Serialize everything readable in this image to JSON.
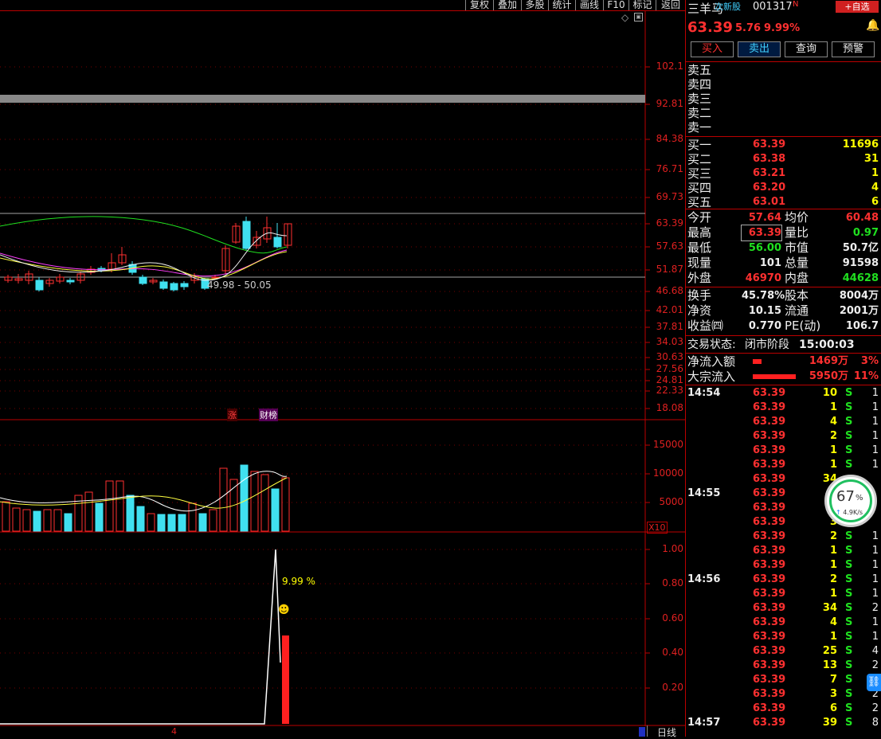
{
  "toolbar": {
    "buttons": [
      "复权",
      "叠加",
      "多股",
      "统计",
      "画线",
      "F10",
      "标记",
      "返回"
    ]
  },
  "kline": {
    "y_labels": [
      "102.1",
      "92.81",
      "84.38",
      "76.71",
      "69.73",
      "63.39",
      "57.63",
      "51.87",
      "46.68",
      "42.01",
      "37.81",
      "34.03",
      "30.63",
      "27.56",
      "24.81",
      "22.33",
      "18.08"
    ],
    "range_label": "49.98 - 50.05",
    "tags": [
      "涨",
      "财榜"
    ]
  },
  "volume": {
    "y_labels": [
      "15000",
      "10000",
      "5000"
    ],
    "unit": "X10"
  },
  "indicator": {
    "y_labels": [
      "1.00",
      "0.80",
      "0.60",
      "0.40",
      "0.20"
    ],
    "pct_label": "9.99 %"
  },
  "bottom": {
    "date_mark": "4",
    "period": "日线"
  },
  "stock": {
    "name": "三羊马",
    "tag": "次新股",
    "code": "001317",
    "n": "N",
    "add_button": "+自选",
    "price": "63.39",
    "change": "5.76",
    "pct": "9.99%"
  },
  "actions": [
    "买入",
    "卖出",
    "查询",
    "预警"
  ],
  "sells": [
    "卖五",
    "卖四",
    "卖三",
    "卖二",
    "卖一"
  ],
  "buys": [
    {
      "label": "买一",
      "price": "63.39",
      "vol": "11696"
    },
    {
      "label": "买二",
      "price": "63.38",
      "vol": "31"
    },
    {
      "label": "买三",
      "price": "63.21",
      "vol": "1"
    },
    {
      "label": "买四",
      "price": "63.20",
      "vol": "4"
    },
    {
      "label": "买五",
      "price": "63.01",
      "vol": "6"
    }
  ],
  "stats": [
    {
      "l1": "今开",
      "v1": "57.64",
      "l2": "均价",
      "v2": "60.48"
    },
    {
      "l1": "最高",
      "v1": "63.39",
      "l2": "量比",
      "v2": "0.97"
    },
    {
      "l1": "最低",
      "v1": "56.00",
      "l2": "市值",
      "v2": "50.7亿"
    },
    {
      "l1": "现量",
      "v1": "101",
      "l2": "总量",
      "v2": "91598"
    },
    {
      "l1": "外盘",
      "v1": "46970",
      "l2": "内盘",
      "v2": "44628"
    }
  ],
  "stats2": [
    {
      "l1": "换手",
      "v1": "45.78%",
      "l2": "股本",
      "v2": "8004万"
    },
    {
      "l1": "净资",
      "v1": "10.15",
      "l2": "流通",
      "v2": "2001万"
    },
    {
      "l1": "收益㈣",
      "v1": "0.770",
      "l2": "PE(动)",
      "v2": "106.7"
    }
  ],
  "status": {
    "label": "交易状态:",
    "value": "闭市阶段",
    "time": "15:00:03"
  },
  "flows": [
    {
      "label": "净流入额",
      "value": "1469万",
      "pct": "3%",
      "fill": 0.2
    },
    {
      "label": "大宗流入",
      "value": "5950万",
      "pct": "11%",
      "fill": 1.0
    }
  ],
  "ticks": [
    {
      "time": "14:54",
      "price": "63.39",
      "vol": "10",
      "side": "S",
      "n": "1"
    },
    {
      "time": "",
      "price": "63.39",
      "vol": "1",
      "side": "S",
      "n": "1"
    },
    {
      "time": "",
      "price": "63.39",
      "vol": "4",
      "side": "S",
      "n": "1"
    },
    {
      "time": "",
      "price": "63.39",
      "vol": "2",
      "side": "S",
      "n": "1"
    },
    {
      "time": "",
      "price": "63.39",
      "vol": "1",
      "side": "S",
      "n": "1"
    },
    {
      "time": "",
      "price": "63.39",
      "vol": "1",
      "side": "S",
      "n": "1"
    },
    {
      "time": "",
      "price": "63.39",
      "vol": "34",
      "side": "",
      "n": ""
    },
    {
      "time": "14:55",
      "price": "63.39",
      "vol": "",
      "side": "",
      "n": ""
    },
    {
      "time": "",
      "price": "63.39",
      "vol": "",
      "side": "",
      "n": ""
    },
    {
      "time": "",
      "price": "63.39",
      "vol": "3",
      "side": "",
      "n": ""
    },
    {
      "time": "",
      "price": "63.39",
      "vol": "2",
      "side": "S",
      "n": "1"
    },
    {
      "time": "",
      "price": "63.39",
      "vol": "1",
      "side": "S",
      "n": "1"
    },
    {
      "time": "",
      "price": "63.39",
      "vol": "1",
      "side": "S",
      "n": "1"
    },
    {
      "time": "14:56",
      "price": "63.39",
      "vol": "2",
      "side": "S",
      "n": "1"
    },
    {
      "time": "",
      "price": "63.39",
      "vol": "1",
      "side": "S",
      "n": "1"
    },
    {
      "time": "",
      "price": "63.39",
      "vol": "34",
      "side": "S",
      "n": "2"
    },
    {
      "time": "",
      "price": "63.39",
      "vol": "4",
      "side": "S",
      "n": "1"
    },
    {
      "time": "",
      "price": "63.39",
      "vol": "1",
      "side": "S",
      "n": "1"
    },
    {
      "time": "",
      "price": "63.39",
      "vol": "25",
      "side": "S",
      "n": "4"
    },
    {
      "time": "",
      "price": "63.39",
      "vol": "13",
      "side": "S",
      "n": "2"
    },
    {
      "time": "",
      "price": "63.39",
      "vol": "7",
      "side": "S",
      "n": ""
    },
    {
      "time": "",
      "price": "63.39",
      "vol": "3",
      "side": "S",
      "n": "2"
    },
    {
      "time": "",
      "price": "63.39",
      "vol": "6",
      "side": "S",
      "n": "2"
    },
    {
      "time": "14:57",
      "price": "63.39",
      "vol": "39",
      "side": "S",
      "n": "8"
    }
  ],
  "speed": {
    "pct": "67",
    "pct_unit": "%",
    "rate": "4.9K/s"
  }
}
